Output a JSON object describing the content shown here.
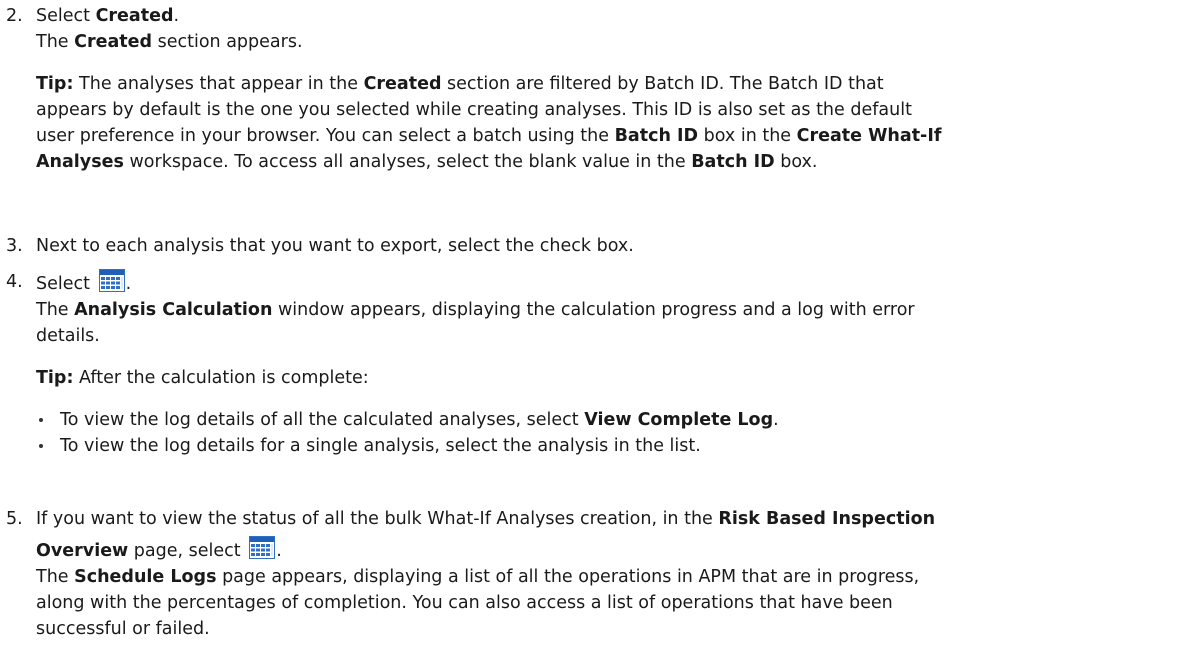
{
  "steps": [
    {
      "number": "2.",
      "action_prefix": "Select ",
      "action_bold": "Created",
      "action_suffix": ".",
      "result_prefix": "The ",
      "result_bold": "Created",
      "result_suffix": " section appears.",
      "tip": {
        "label": "Tip:",
        "line1_a": " The analyses that appear in the ",
        "line1_b": "Created",
        "line1_c": " section are filtered by Batch ID. The Batch ID that",
        "line2": "appears by default is the one you selected while creating analyses. This ID is also set as the default",
        "line3_a": "user preference in your browser. You can select a batch using the ",
        "line3_b": "Batch ID",
        "line3_c": " box in the ",
        "line3_d": "Create What-If",
        "line4_a": "Analyses",
        "line4_b": " workspace. To access all analyses, select the blank value in the ",
        "line4_c": "Batch ID",
        "line4_d": " box."
      }
    },
    {
      "number": "3.",
      "text": "Next to each analysis that you want to export, select the check box."
    },
    {
      "number": "4.",
      "action_prefix": "Select ",
      "action_icon": "calendar-icon",
      "action_suffix": ".",
      "result_prefix": "The ",
      "result_bold": "Analysis Calculation",
      "result_suffix": " window appears, displaying the calculation progress and a log with error",
      "result_line2": "details.",
      "tip": {
        "label": "Tip:",
        "text": " After the calculation is complete:"
      },
      "bullets": [
        {
          "prefix": "To view the log details of all the calculated analyses, select ",
          "bold": "View Complete Log",
          "suffix": "."
        },
        {
          "prefix": "To view the log details for a single analysis, select the analysis in the list.",
          "bold": "",
          "suffix": ""
        }
      ]
    },
    {
      "number": "5.",
      "line1_a": "If you want to view the status of all the bulk What-If Analyses creation, in the ",
      "line1_b": "Risk Based Inspection",
      "line2_a": "Overview",
      "line2_b": " page, select ",
      "line2_icon": "calendar-icon",
      "line2_c": ".",
      "result_prefix": "The ",
      "result_bold": "Schedule Logs",
      "result_line1": " page appears, displaying a list of all the operations in APM that are in progress,",
      "result_line2": "along with the percentages of completion. You can also access a list of operations that have been",
      "result_line3": "successful or failed."
    }
  ],
  "icon_colors": {
    "frame": "#2f6fc6",
    "header": "#1f5fb8",
    "cell": "#dfeaf8"
  }
}
